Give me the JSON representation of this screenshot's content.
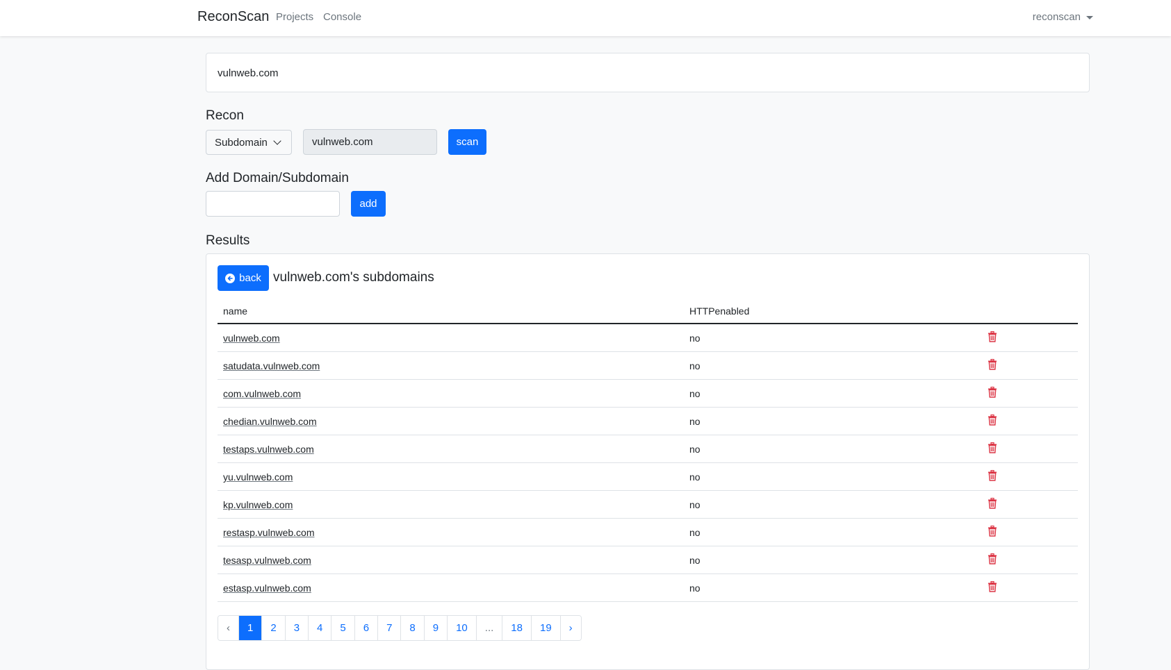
{
  "navbar": {
    "brand": "ReconScan",
    "links": [
      "Projects",
      "Console"
    ],
    "user": "reconscan"
  },
  "project": {
    "name": "vulnweb.com"
  },
  "recon": {
    "title": "Recon",
    "select_value": "Subdomain",
    "target_value": "vulnweb.com",
    "scan_label": "scan"
  },
  "add_domain": {
    "title": "Add Domain/Subdomain",
    "input_value": "",
    "add_label": "add"
  },
  "results": {
    "title": "Results",
    "back_label": "back",
    "heading": "vulnweb.com's subdomains",
    "columns": [
      "name",
      "HTTPenabled"
    ],
    "rows": [
      {
        "name": "vulnweb.com",
        "http": "no"
      },
      {
        "name": "satudata.vulnweb.com",
        "http": "no"
      },
      {
        "name": "com.vulnweb.com",
        "http": "no"
      },
      {
        "name": "chedian.vulnweb.com",
        "http": "no"
      },
      {
        "name": "testaps.vulnweb.com",
        "http": "no"
      },
      {
        "name": "yu.vulnweb.com",
        "http": "no"
      },
      {
        "name": "kp.vulnweb.com",
        "http": "no"
      },
      {
        "name": "restasp.vulnweb.com",
        "http": "no"
      },
      {
        "name": "tesasp.vulnweb.com",
        "http": "no"
      },
      {
        "name": "estasp.vulnweb.com",
        "http": "no"
      }
    ],
    "delete_icon": "trash-icon",
    "delete_color": "#dc3545"
  },
  "pagination": {
    "prev": "‹",
    "next": "›",
    "pages": [
      "1",
      "2",
      "3",
      "4",
      "5",
      "6",
      "7",
      "8",
      "9",
      "10",
      "...",
      "18",
      "19"
    ],
    "active": "1"
  },
  "colors": {
    "primary": "#0d6efd",
    "background": "#f8f9fa",
    "danger": "#dc3545"
  }
}
